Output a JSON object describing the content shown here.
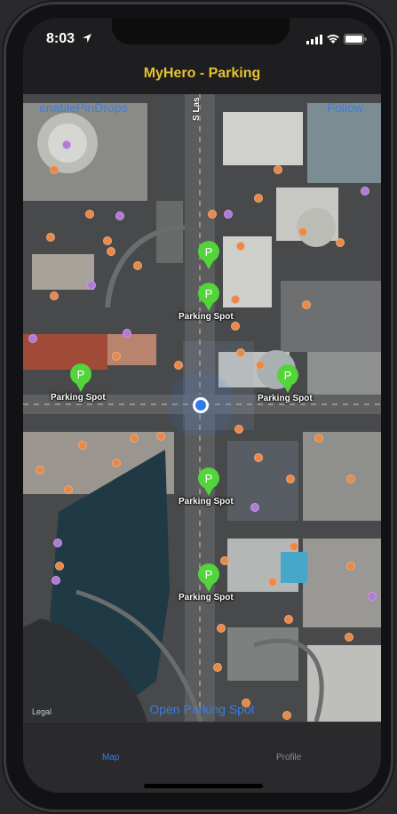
{
  "status_bar": {
    "time": "8:03"
  },
  "nav": {
    "title": "MyHero - Parking"
  },
  "map": {
    "enable_pin_drops_label": "enablePinDrops",
    "follow_label": "Follow",
    "open_spot_label": "Open Parking Spot",
    "legal_label": "Legal",
    "street_label": "S Las",
    "pin_labels": [
      "Parking Spot",
      "Parking Spot",
      "Parking Spot",
      "Parking Spot",
      "Parking Spot"
    ],
    "pin_glyph": "P"
  },
  "tabs": [
    {
      "label": "Map",
      "selected": true
    },
    {
      "label": "Profile",
      "selected": false
    }
  ],
  "colors": {
    "title": "#e5c22f",
    "accent": "#3d7de0",
    "pin": "#52d43a",
    "user_location": "#2f7bea"
  }
}
